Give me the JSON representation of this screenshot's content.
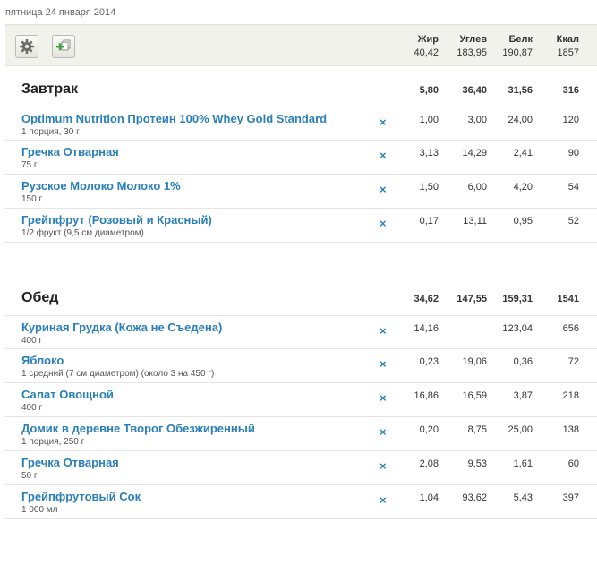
{
  "date": "пятница 24 января 2014",
  "toolbar": {
    "settings_icon": "gear-icon",
    "add_icon": "add-copy-icon",
    "accent": "#2a7fb8"
  },
  "columns": {
    "fat": "Жир",
    "carb": "Углев",
    "protein": "Белк",
    "kcal": "Ккал"
  },
  "totals": {
    "fat": "40,42",
    "carb": "183,95",
    "protein": "190,87",
    "kcal": "1857"
  },
  "delete_symbol": "×",
  "meals": [
    {
      "title": "Завтрак",
      "totals": {
        "fat": "5,80",
        "carb": "36,40",
        "protein": "31,56",
        "kcal": "316"
      },
      "items": [
        {
          "name": "Optimum Nutrition Протеин 100% Whey Gold Standard",
          "portion": "1 порция, 30 г",
          "fat": "1,00",
          "carb": "3,00",
          "protein": "24,00",
          "kcal": "120"
        },
        {
          "name": "Гречка Отварная",
          "portion": "75 г",
          "fat": "3,13",
          "carb": "14,29",
          "protein": "2,41",
          "kcal": "90"
        },
        {
          "name": "Рузское Молоко Молоко 1%",
          "portion": "150 г",
          "fat": "1,50",
          "carb": "6,00",
          "protein": "4,20",
          "kcal": "54"
        },
        {
          "name": "Грейпфрут (Розовый и Красный)",
          "portion": "1/2 фрукт (9,5 см диаметром)",
          "fat": "0,17",
          "carb": "13,11",
          "protein": "0,95",
          "kcal": "52"
        }
      ]
    },
    {
      "title": "Обед",
      "totals": {
        "fat": "34,62",
        "carb": "147,55",
        "protein": "159,31",
        "kcal": "1541"
      },
      "items": [
        {
          "name": "Куриная Грудка (Кожа не Съедена)",
          "portion": "400 г",
          "fat": "14,16",
          "carb": "",
          "protein": "123,04",
          "kcal": "656"
        },
        {
          "name": "Яблоко",
          "portion": "1 средний (7 см диаметром) (около 3 на 450 г)",
          "fat": "0,23",
          "carb": "19,06",
          "protein": "0,36",
          "kcal": "72"
        },
        {
          "name": "Салат Овощной",
          "portion": "400 г",
          "fat": "16,86",
          "carb": "16,59",
          "protein": "3,87",
          "kcal": "218"
        },
        {
          "name": "Домик в деревне Творог Обезжиренный",
          "portion": "1 порция, 250 г",
          "fat": "0,20",
          "carb": "8,75",
          "protein": "25,00",
          "kcal": "138"
        },
        {
          "name": "Гречка Отварная",
          "portion": "50 г",
          "fat": "2,08",
          "carb": "9,53",
          "protein": "1,61",
          "kcal": "60"
        },
        {
          "name": "Грейпфрутовый Сок",
          "portion": "1 000 мл",
          "fat": "1,04",
          "carb": "93,62",
          "protein": "5,43",
          "kcal": "397"
        }
      ]
    }
  ]
}
